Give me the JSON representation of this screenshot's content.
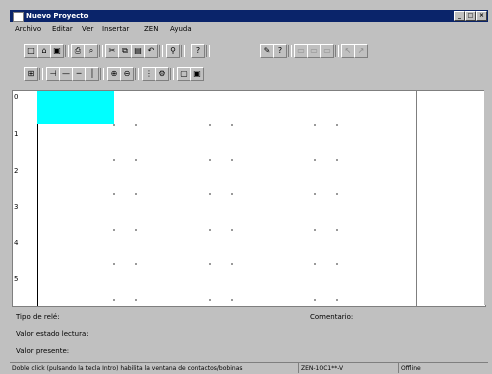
{
  "window": {
    "title": "Nuevo Proyecto",
    "controls": {
      "minimize": "_",
      "maximize": "□",
      "close": "×"
    }
  },
  "menu": {
    "items": [
      "Archivo",
      "Editar",
      "Ver",
      "Insertar",
      "ZEN",
      "Ayuda"
    ]
  },
  "toolbar1": {
    "buttons": [
      {
        "icon": "new-document-icon",
        "glyph": "□"
      },
      {
        "icon": "open-folder-icon",
        "glyph": "⌂"
      },
      {
        "icon": "save-icon",
        "glyph": "▣"
      },
      {
        "icon": "print-icon",
        "glyph": "⎙"
      },
      {
        "icon": "print-preview-icon",
        "glyph": "⌕"
      },
      {
        "icon": "cut-icon",
        "glyph": "✂"
      },
      {
        "icon": "copy-icon",
        "glyph": "⧉"
      },
      {
        "icon": "paste-icon",
        "glyph": "▤"
      },
      {
        "icon": "undo-icon",
        "glyph": "↶"
      },
      {
        "icon": "find-icon",
        "glyph": "⚲"
      },
      {
        "icon": "help-icon",
        "glyph": "?"
      },
      {
        "icon": "settings-icon",
        "glyph": "✎"
      },
      {
        "icon": "help-context-icon",
        "glyph": "?"
      },
      {
        "icon": "disabled-1-icon",
        "glyph": "▭"
      },
      {
        "icon": "disabled-2-icon",
        "glyph": "▭"
      },
      {
        "icon": "disabled-3-icon",
        "glyph": "▭"
      },
      {
        "icon": "disabled-4-icon",
        "glyph": "↖"
      },
      {
        "icon": "disabled-5-icon",
        "glyph": "↗"
      }
    ]
  },
  "toolbar2": {
    "buttons": [
      {
        "icon": "select-icon",
        "glyph": "⊞"
      },
      {
        "icon": "contact-icon",
        "glyph": "⊣"
      },
      {
        "icon": "wire-icon",
        "glyph": "—"
      },
      {
        "icon": "line-icon",
        "glyph": "─"
      },
      {
        "icon": "vertical-line-icon",
        "glyph": "│"
      },
      {
        "icon": "zoom-in-icon",
        "glyph": "⊕"
      },
      {
        "icon": "zoom-out-icon",
        "glyph": "⊖"
      },
      {
        "icon": "grid-icon",
        "glyph": "⋮"
      },
      {
        "icon": "run-icon",
        "glyph": "⚙"
      },
      {
        "icon": "page-icon",
        "glyph": "▢"
      },
      {
        "icon": "page-2-icon",
        "glyph": "▣"
      }
    ]
  },
  "canvas": {
    "row_numbers": [
      "0",
      "1",
      "2",
      "3",
      "4",
      "5"
    ]
  },
  "info": {
    "tipo_label": "Tipo de relé:",
    "valor_escrito_label": "Valor estado lectura:",
    "valor_presente_label": "Valor presente:",
    "comentario_label": "Comentario:"
  },
  "footer": {
    "hint": "Doble click (pulsando la tecla Intro) habilita la ventana de contactos/bobinas",
    "model": "ZEN-10C1**-V",
    "mode": "Offline"
  }
}
